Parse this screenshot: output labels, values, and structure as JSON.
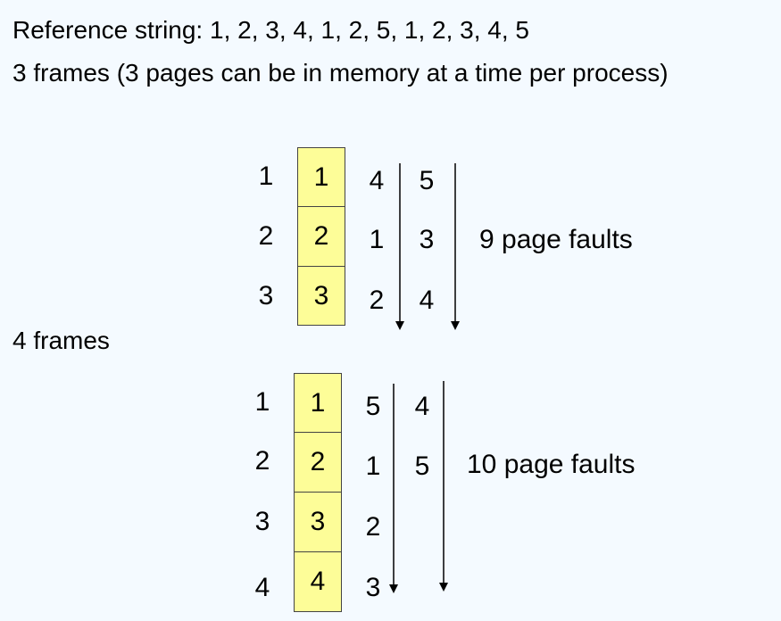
{
  "header": {
    "reference_string": "Reference string: 1, 2, 3, 4, 1, 2, 5, 1, 2, 3, 4, 5",
    "three_frames_desc": "3 frames (3 pages can be in memory at a time per process)",
    "four_frames_label": "4 frames"
  },
  "diagram3": {
    "row_labels": [
      "1",
      "2",
      "3"
    ],
    "frames": [
      "1",
      "2",
      "3"
    ],
    "column1": [
      "4",
      "1",
      "2"
    ],
    "column2": [
      "5",
      "3",
      "4"
    ],
    "faults": "9 page faults"
  },
  "diagram4": {
    "row_labels": [
      "1",
      "2",
      "3",
      "4"
    ],
    "frames": [
      "1",
      "2",
      "3",
      "4"
    ],
    "column1": [
      "5",
      "1",
      "2",
      "3"
    ],
    "column2": [
      "4",
      "5"
    ],
    "faults": "10 page faults"
  }
}
